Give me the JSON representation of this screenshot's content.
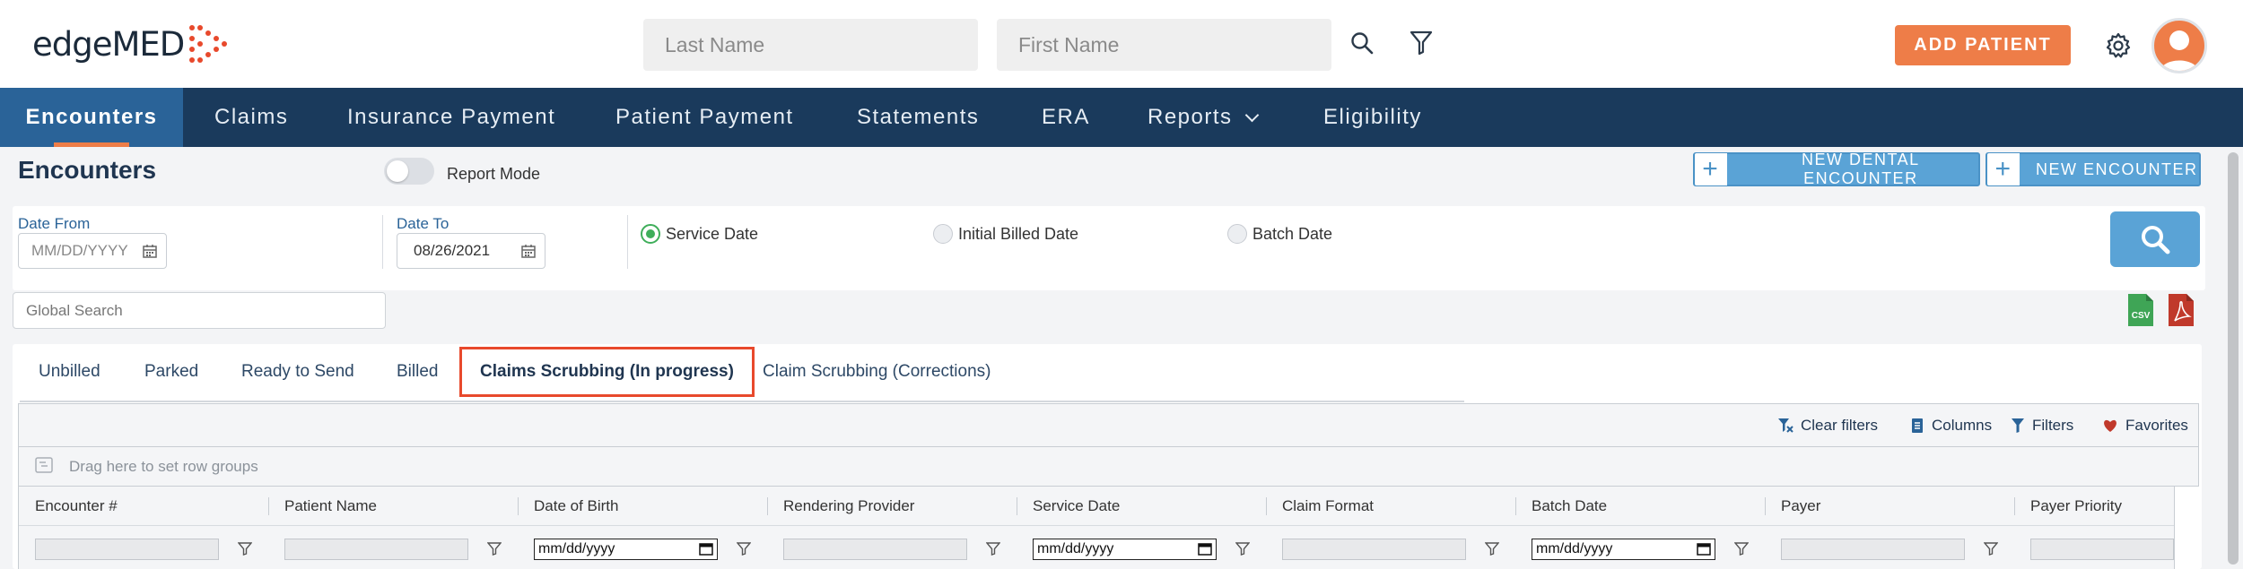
{
  "header": {
    "logo_text": "edgeMED",
    "last_name_placeholder": "Last Name",
    "first_name_placeholder": "First Name",
    "add_patient_label": "ADD PATIENT",
    "brand_color": "#ee7d48"
  },
  "nav": {
    "items": [
      {
        "label": "Encounters",
        "active": true
      },
      {
        "label": "Claims"
      },
      {
        "label": "Insurance Payment"
      },
      {
        "label": "Patient Payment"
      },
      {
        "label": "Statements"
      },
      {
        "label": "ERA"
      },
      {
        "label": "Reports",
        "has_dropdown": true
      },
      {
        "label": "Eligibility"
      }
    ]
  },
  "page": {
    "title": "Encounters",
    "report_mode_label": "Report Mode",
    "new_dental_encounter_label": "NEW DENTAL ENCOUNTER",
    "new_encounter_label": "NEW ENCOUNTER"
  },
  "date_filter": {
    "date_from_label": "Date From",
    "date_from_placeholder": "MM/DD/YYYY",
    "date_to_label": "Date To",
    "date_to_value": "08/26/2021",
    "radios": [
      {
        "label": "Service Date",
        "selected": true
      },
      {
        "label": "Initial Billed Date",
        "selected": false
      },
      {
        "label": "Batch Date",
        "selected": false
      }
    ]
  },
  "global_search": {
    "placeholder": "Global Search"
  },
  "exports": {
    "csv_label": "CSV"
  },
  "tabs": [
    {
      "label": "Unbilled"
    },
    {
      "label": "Parked"
    },
    {
      "label": "Ready to Send"
    },
    {
      "label": "Billed"
    },
    {
      "label": "Claims Scrubbing (In progress)",
      "active": true
    },
    {
      "label": "Claim Scrubbing (Corrections)"
    }
  ],
  "grid": {
    "toolbar": {
      "clear_filters": "Clear filters",
      "columns": "Columns",
      "filters": "Filters",
      "favorites": "Favorites"
    },
    "group_bar_text": "Drag here to set row groups",
    "columns": [
      {
        "label": "Encounter #",
        "filter": "text"
      },
      {
        "label": "Patient Name",
        "filter": "text"
      },
      {
        "label": "Date of Birth",
        "filter": "date"
      },
      {
        "label": "Rendering Provider",
        "filter": "text"
      },
      {
        "label": "Service Date",
        "filter": "date"
      },
      {
        "label": "Claim Format",
        "filter": "text"
      },
      {
        "label": "Batch Date",
        "filter": "date"
      },
      {
        "label": "Payer",
        "filter": "text"
      },
      {
        "label": "Payer Priority",
        "filter": "text"
      }
    ],
    "date_placeholder": "mm/dd/yyyy"
  }
}
